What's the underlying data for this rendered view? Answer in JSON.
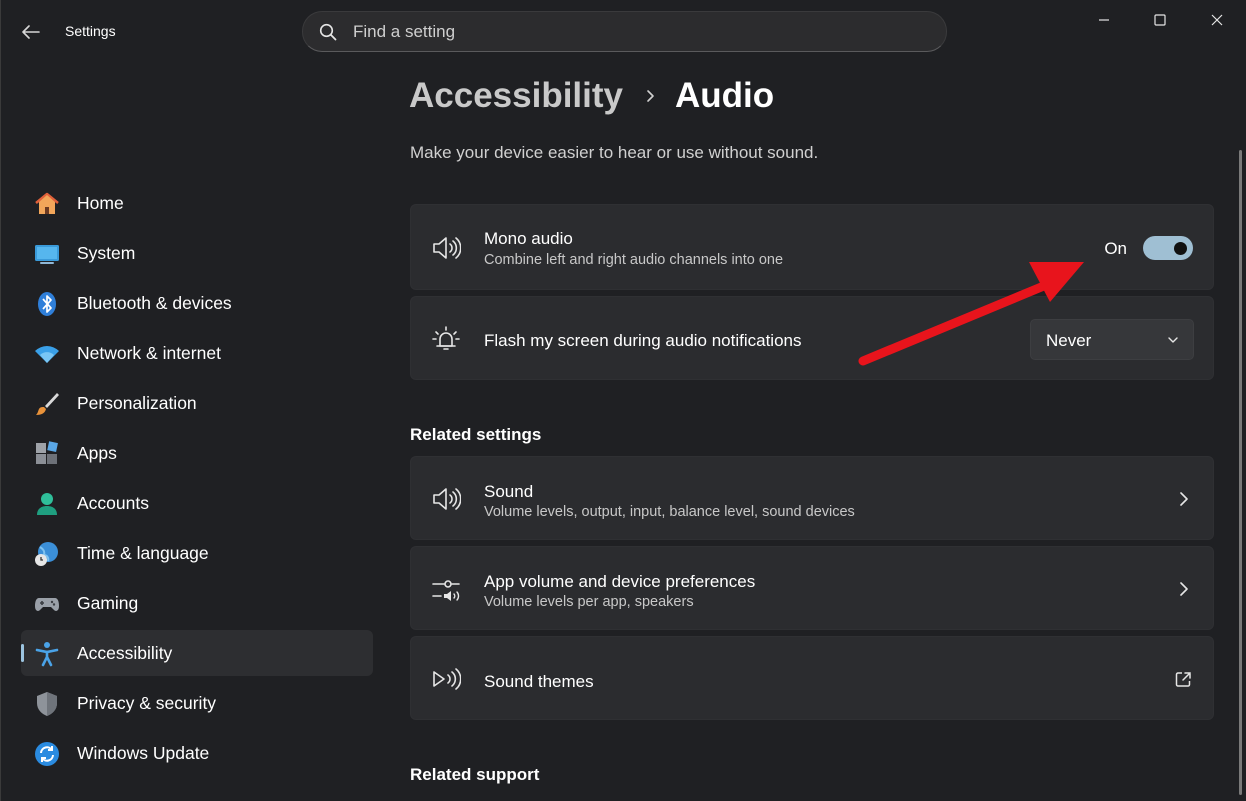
{
  "window": {
    "title": "Settings"
  },
  "search": {
    "placeholder": "Find a setting"
  },
  "sidebar": {
    "items": [
      {
        "label": "Home"
      },
      {
        "label": "System"
      },
      {
        "label": "Bluetooth & devices"
      },
      {
        "label": "Network & internet"
      },
      {
        "label": "Personalization"
      },
      {
        "label": "Apps"
      },
      {
        "label": "Accounts"
      },
      {
        "label": "Time & language"
      },
      {
        "label": "Gaming"
      },
      {
        "label": "Accessibility",
        "active": true
      },
      {
        "label": "Privacy & security"
      },
      {
        "label": "Windows Update"
      }
    ]
  },
  "breadcrumb": {
    "parent": "Accessibility",
    "current": "Audio"
  },
  "description": "Make your device easier to hear or use without sound.",
  "settings": {
    "mono_audio": {
      "title": "Mono audio",
      "subtitle": "Combine left and right audio channels into one",
      "state_label": "On",
      "enabled": true
    },
    "flash_screen": {
      "title": "Flash my screen during audio notifications",
      "value": "Never"
    }
  },
  "related_settings": {
    "heading": "Related settings",
    "items": [
      {
        "title": "Sound",
        "subtitle": "Volume levels, output, input, balance level, sound devices"
      },
      {
        "title": "App volume and device preferences",
        "subtitle": "Volume levels per app, speakers"
      },
      {
        "title": "Sound themes"
      }
    ]
  },
  "related_support": {
    "heading": "Related support"
  },
  "colors": {
    "accent": "#9fbfd3",
    "background": "#1f2023",
    "card": "#2b2c2f",
    "annotation_arrow": "#e8141c"
  }
}
